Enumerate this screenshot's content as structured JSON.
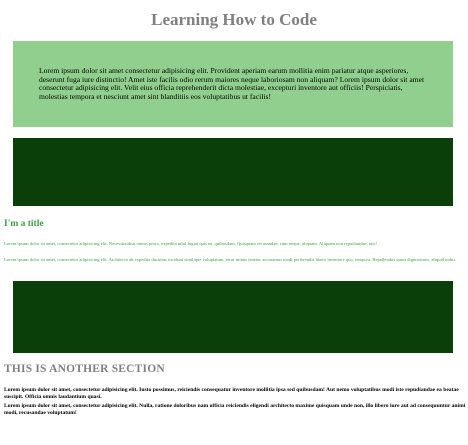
{
  "header": {
    "title": "Learning How to Code"
  },
  "intro": {
    "text": "Lorem ipsum dolor sit amet consectetur adipisicing elit. Provident aperiam earum mollitia enim pariatur atque asperiores, deserunt fuga iure distinctio! Amet iste facilis odio rerum maiores neque laboriosam non aliquam? Lorem ipsum dolor sit amet consectetur adipisicing elit. Velit eius officia reprehenderit dicta molestiae, excepturi inventore aut officiis! Perspiciatis, molestias tempora et nesciunt amet sint blanditiis eos voluptatibus ut facilis!"
  },
  "section_one": {
    "title": "I'm a title",
    "paragraphs": [
      "Lorem ipsum dolor sit amet, consectetur adipisicing elit. Necessitatibus omnis porro, expedita nihil fugiat quis ea, quibusdam. Quisquam recusandae, cum neque, aliquam. Aliquam non repudiandae, nisi!",
      "Lorem ipsum dolor sit amet, consectetur adipisicing elit. Architecto ab expedita ducimus incidunt similique voluptatum, error minus tenetur accusamus modi perferendis libero inventore quo, tempora. Repellendus quasi dignissimos, aliquid nobis."
    ]
  },
  "section_two": {
    "title": "THIS IS ANOTHER SECTION",
    "paragraphs": [
      "Lorem ipsum dolor sit amet, consectetur adipisicing elit. Iusto possimus, reiciendis consequatur inventore mollitia ipsa sed quibusdam! Aut nemo voluptatibus modi iste repudiandae ea beatae suscipit. Officia omnis laudantium quasi.",
      "Lorem ipsum dolor sit amet, consectetur adipisicing elit. Nulla, ratione doloribus nam officia reiciendis eligendi architecto maxime quisquam unde non, illo libero iure aut ad consequuntur animi modi, recusandae voluptatum!"
    ]
  },
  "colors": {
    "light_green": "#90cf8e",
    "dark_green": "#0a3f0a",
    "accent_green": "#3ca243",
    "heading_gray": "#808080"
  }
}
